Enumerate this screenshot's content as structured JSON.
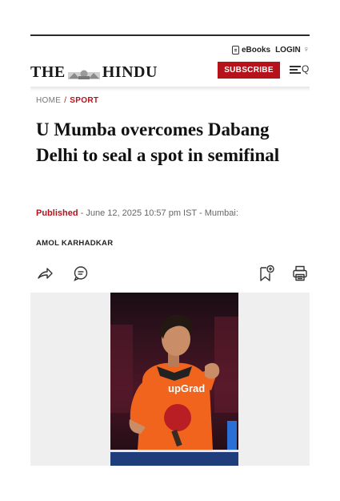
{
  "header": {
    "ebooks_label": "eBooks",
    "login_label": "LOGIN",
    "logo_text_left": "THE",
    "logo_text_right": "HINDU",
    "subscribe_label": "SUBSCRIBE"
  },
  "breadcrumb": {
    "home": "HOME",
    "separator": "/",
    "section": "SPORT"
  },
  "article": {
    "headline": "U Mumba overcomes Dabang Delhi to seal a spot in semifinal",
    "published_label": "Published",
    "dateline": " - June 12, 2025 10:57 pm IST - Mumbai:",
    "author": "AMOL KARHADKAR"
  },
  "photo": {
    "jersey_text": "upGrad"
  },
  "colors": {
    "accent_red": "#b5121b",
    "jersey_orange": "#f0641e"
  },
  "icons": [
    "ebook-icon",
    "login-icon",
    "menu-icon",
    "search-icon",
    "share-icon",
    "comment-icon",
    "bookmark-add-icon",
    "print-icon"
  ]
}
